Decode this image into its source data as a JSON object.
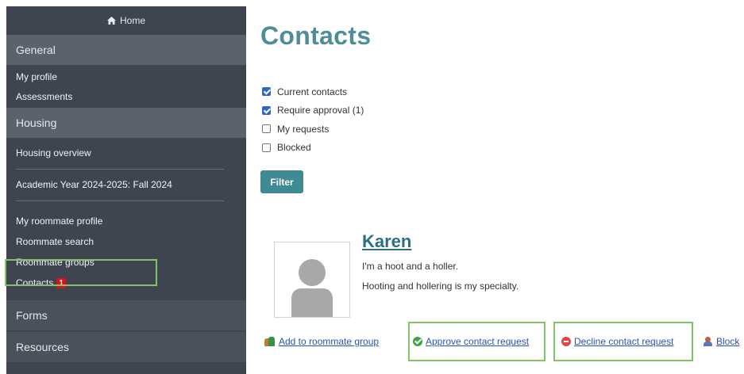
{
  "sidebar": {
    "home_label": "Home",
    "sections": {
      "general": "General",
      "housing": "Housing",
      "forms": "Forms",
      "resources": "Resources"
    },
    "general_items": [
      "My profile",
      "Assessments"
    ],
    "housing_items": [
      "Housing overview",
      "Academic Year 2024-2025: Fall 2024"
    ],
    "roommate_items": [
      "My roommate profile",
      "Roommate search",
      "Roommate groups"
    ],
    "contacts_label": "Contacts",
    "contacts_badge": "1"
  },
  "main": {
    "title": "Contacts",
    "filters": [
      {
        "label": "Current contacts",
        "checked": true
      },
      {
        "label": "Require approval (1)",
        "checked": true
      },
      {
        "label": "My requests",
        "checked": false
      },
      {
        "label": "Blocked",
        "checked": false
      }
    ],
    "filter_button": "Filter",
    "contact": {
      "name": "Karen",
      "bio_line1": "I'm a hoot and a holler.",
      "bio_line2": "Hooting and hollering is my specialty."
    },
    "actions": {
      "add_group": "Add to roommate group",
      "approve": "Approve contact request",
      "decline": "Decline contact request",
      "block": "Block"
    }
  },
  "colors": {
    "sidebar_bg": "#3e4550",
    "accent": "#4f8d99",
    "button": "#3f8a94",
    "link": "#2654b6",
    "badge": "#d9121c",
    "highlight": "#82c46a"
  }
}
